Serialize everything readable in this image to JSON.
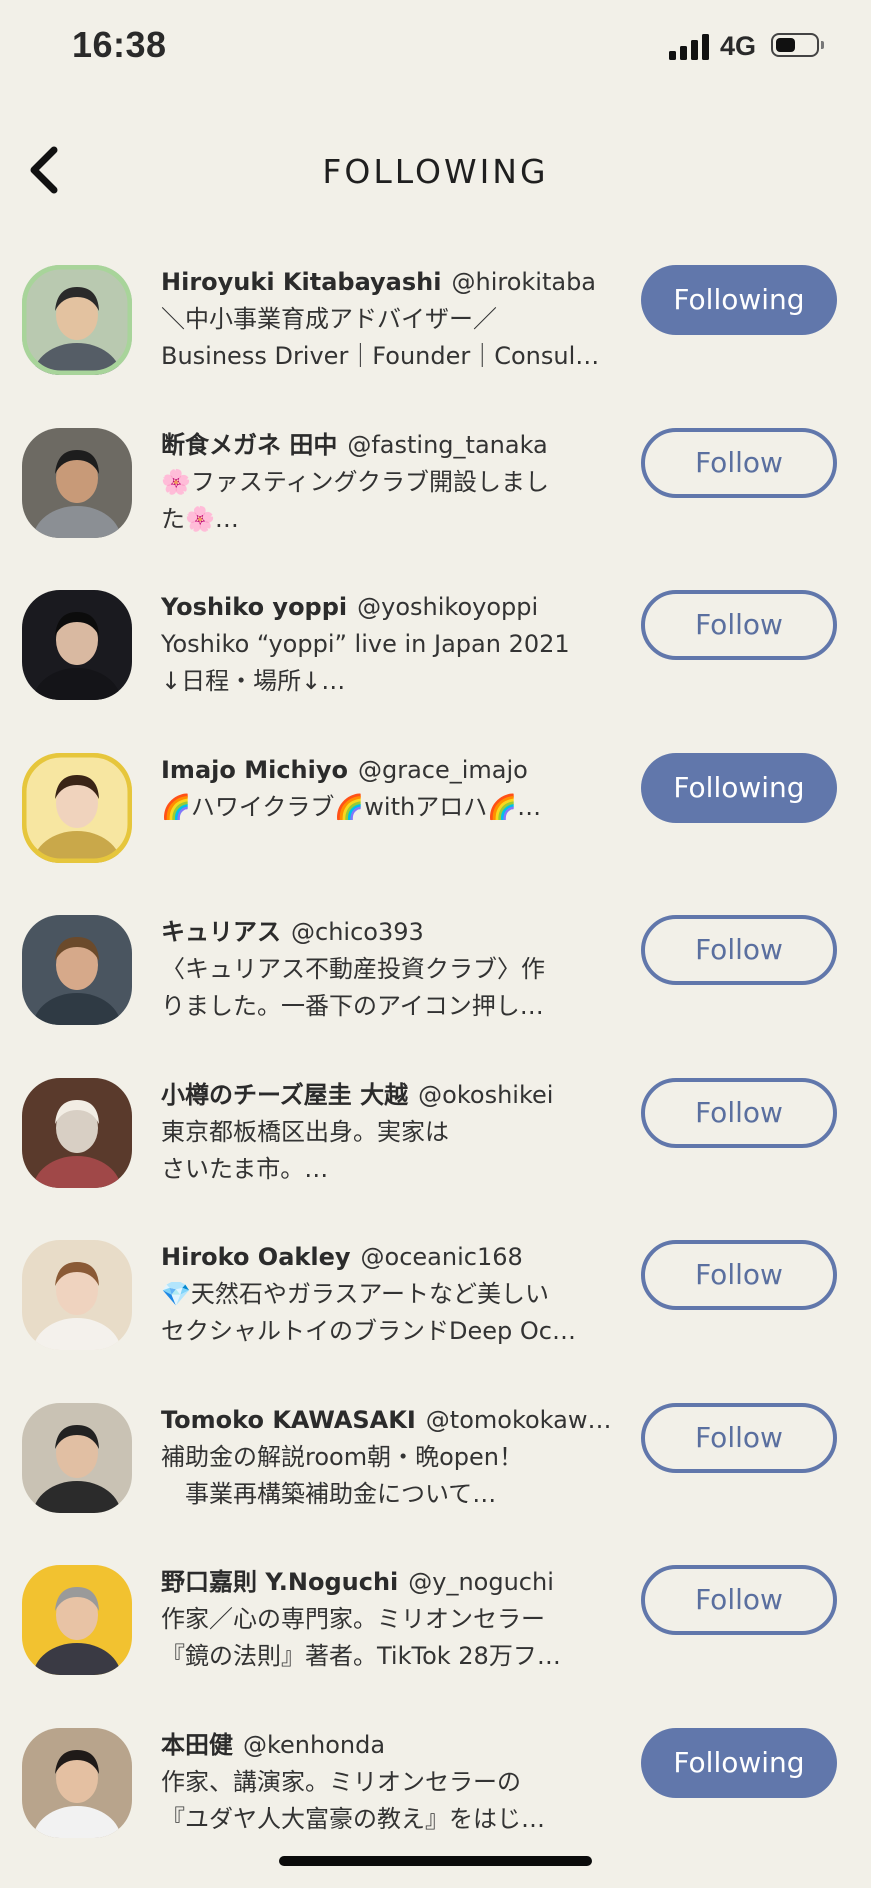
{
  "status": {
    "time": "16:38",
    "network": "4G",
    "battery_level": 0.5
  },
  "header": {
    "title": "FOLLOWING",
    "back_icon": "chevron-left-icon"
  },
  "colors": {
    "background": "#f2f0e8",
    "accent": "#6177ab"
  },
  "users": [
    {
      "name": "Hiroyuki Kitabayashi",
      "handle": "@hirokitaba",
      "bio": "＼中小事業育成アドバイザー／\nBusiness Driver｜Founder｜Consul…",
      "status": "Following"
    },
    {
      "name": "断食メガネ 田中",
      "handle": "@fasting_tanaka",
      "bio": "🌸ファスティングクラブ開設しまし\nた🌸…",
      "status": "Follow"
    },
    {
      "name": "Yoshiko yoppi",
      "handle": "@yoshikoyoppi",
      "bio": "Yoshiko “yoppi” live in Japan 2021\n↓日程・場所↓…",
      "status": "Follow"
    },
    {
      "name": "Imajo Michiyo",
      "handle": "@grace_imajo",
      "bio": "🌈ハワイクラブ🌈withアロハ🌈…",
      "status": "Following"
    },
    {
      "name": "キュリアス",
      "handle": "@chico393",
      "bio": "〈キュリアス不動産投資クラブ〉作\nりました。一番下のアイコン押し…",
      "status": "Follow"
    },
    {
      "name": "小樽のチーズ屋圭 大越",
      "handle": "@okoshikei",
      "bio": "東京都板橋区出身。実家は\nさいたま市。…",
      "status": "Follow"
    },
    {
      "name": "Hiroko Oakley",
      "handle": "@oceanic168",
      "bio": "💎天然石やガラスアートなど美しい\nセクシャルトイのブランドDeep Oc…",
      "status": "Follow"
    },
    {
      "name": "Tomoko KAWASAKI",
      "handle": "@tomokokaw…",
      "bio": "補助金の解説room朝・晩open！\n　事業再構築補助金について…",
      "status": "Follow"
    },
    {
      "name": "野口嘉則 Y.Noguchi",
      "handle": "@y_noguchi",
      "bio": "作家／心の専門家。ミリオンセラー\n『鏡の法則』著者。TikTok 28万フ…",
      "status": "Follow"
    },
    {
      "name": "本田健",
      "handle": "@kenhonda",
      "bio": "作家、講演家。ミリオンセラーの\n『ユダヤ人大富豪の教え』をはじ…",
      "status": "Following"
    }
  ]
}
